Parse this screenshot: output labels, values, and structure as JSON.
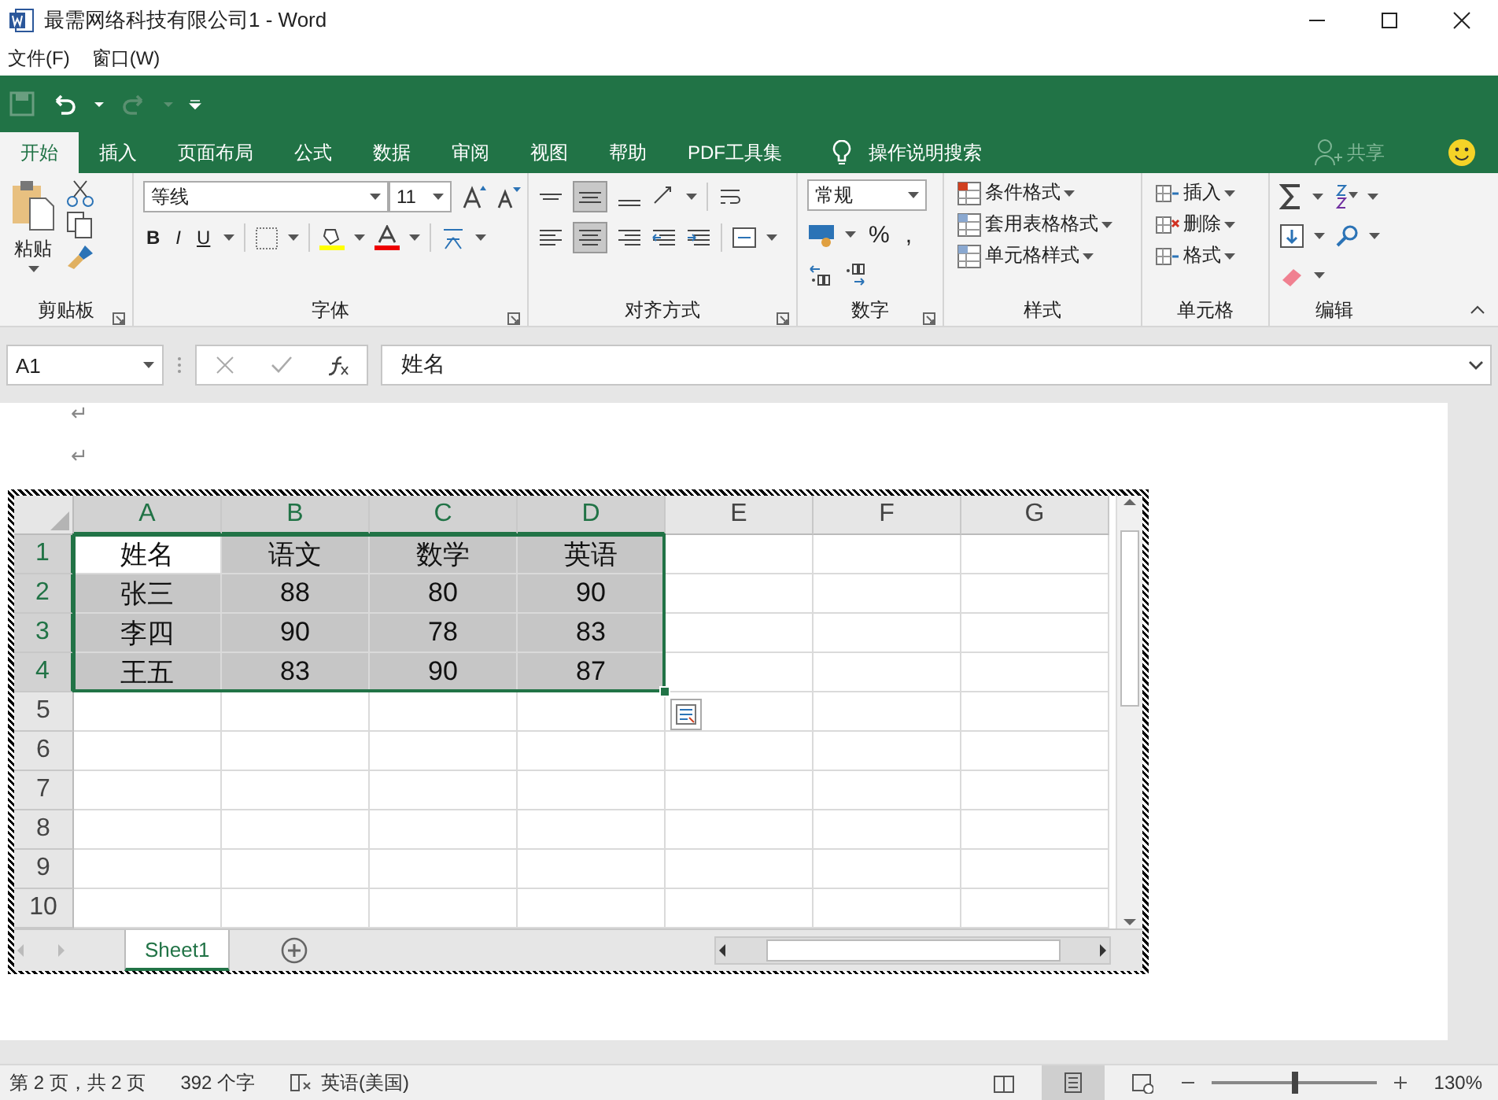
{
  "window": {
    "title": "最需网络科技有限公司1 - Word"
  },
  "menu": [
    "文件(F)",
    "窗口(W)"
  ],
  "tabs": [
    {
      "label": "开始",
      "selected": true
    },
    {
      "label": "插入",
      "selected": false
    },
    {
      "label": "页面布局",
      "selected": false
    },
    {
      "label": "公式",
      "selected": false
    },
    {
      "label": "数据",
      "selected": false
    },
    {
      "label": "审阅",
      "selected": false
    },
    {
      "label": "视图",
      "selected": false
    },
    {
      "label": "帮助",
      "selected": false
    },
    {
      "label": "PDF工具集",
      "selected": false
    }
  ],
  "tell_me": "操作说明搜索",
  "share": "共享",
  "ribbon": [
    {
      "kind": "clipboard",
      "label": "剪贴板",
      "paste": "粘贴"
    },
    {
      "kind": "font",
      "label": "字体",
      "font_name": "等线",
      "font_size": "11",
      "buttons": [
        "B",
        "I",
        "U"
      ]
    },
    {
      "kind": "alignment",
      "label": "对齐方式"
    },
    {
      "kind": "number",
      "label": "数字",
      "format": "常规",
      "symbols": [
        "%",
        ","
      ]
    },
    {
      "kind": "styles",
      "label": "样式",
      "items": [
        "条件格式",
        "套用表格格式",
        "单元格样式"
      ]
    },
    {
      "kind": "cells",
      "label": "单元格",
      "items": [
        "插入",
        "删除",
        "格式"
      ]
    },
    {
      "kind": "editing",
      "label": "编辑"
    }
  ],
  "formula_bar": {
    "name_box": "A1",
    "value": "姓名"
  },
  "paragraph_marks": [
    "↵",
    "↵"
  ],
  "sheet": {
    "columns": [
      {
        "label": "A",
        "selected": true
      },
      {
        "label": "B",
        "selected": true
      },
      {
        "label": "C",
        "selected": true
      },
      {
        "label": "D",
        "selected": true
      },
      {
        "label": "E",
        "selected": false
      },
      {
        "label": "F",
        "selected": false
      },
      {
        "label": "G",
        "selected": false
      }
    ],
    "rows": [
      {
        "header": "1",
        "selected": true,
        "cells": [
          {
            "text": "姓名",
            "selected": true,
            "active": true
          },
          {
            "text": "语文",
            "selected": true,
            "active": false
          },
          {
            "text": "数学",
            "selected": true,
            "active": false
          },
          {
            "text": "英语",
            "selected": true,
            "active": false
          }
        ]
      },
      {
        "header": "2",
        "selected": true,
        "cells": [
          {
            "text": "张三",
            "selected": true,
            "active": false
          },
          {
            "text": "88",
            "selected": true,
            "active": false
          },
          {
            "text": "80",
            "selected": true,
            "active": false
          },
          {
            "text": "90",
            "selected": true,
            "active": false
          }
        ]
      },
      {
        "header": "3",
        "selected": true,
        "cells": [
          {
            "text": "李四",
            "selected": true,
            "active": false
          },
          {
            "text": "90",
            "selected": true,
            "active": false
          },
          {
            "text": "78",
            "selected": true,
            "active": false
          },
          {
            "text": "83",
            "selected": true,
            "active": false
          }
        ]
      },
      {
        "header": "4",
        "selected": true,
        "cells": [
          {
            "text": "王五",
            "selected": true,
            "active": false
          },
          {
            "text": "83",
            "selected": true,
            "active": false
          },
          {
            "text": "90",
            "selected": true,
            "active": false
          },
          {
            "text": "87",
            "selected": true,
            "active": false
          }
        ]
      },
      {
        "header": "5",
        "selected": false
      },
      {
        "header": "6",
        "selected": false
      },
      {
        "header": "7",
        "selected": false
      },
      {
        "header": "8",
        "selected": false
      },
      {
        "header": "9",
        "selected": false
      },
      {
        "header": "10",
        "selected": false
      }
    ],
    "sheet_tabs": [
      {
        "label": "Sheet1",
        "selected": true
      }
    ]
  },
  "status_bar": {
    "page": "第 2 页，共 2 页",
    "words": "392 个字",
    "language": "英语(美国)",
    "views": [
      {
        "selected": false
      },
      {
        "selected": true
      },
      {
        "selected": false
      }
    ],
    "zoom_slider": {
      "level": 0.5
    },
    "zoom": "130%"
  }
}
